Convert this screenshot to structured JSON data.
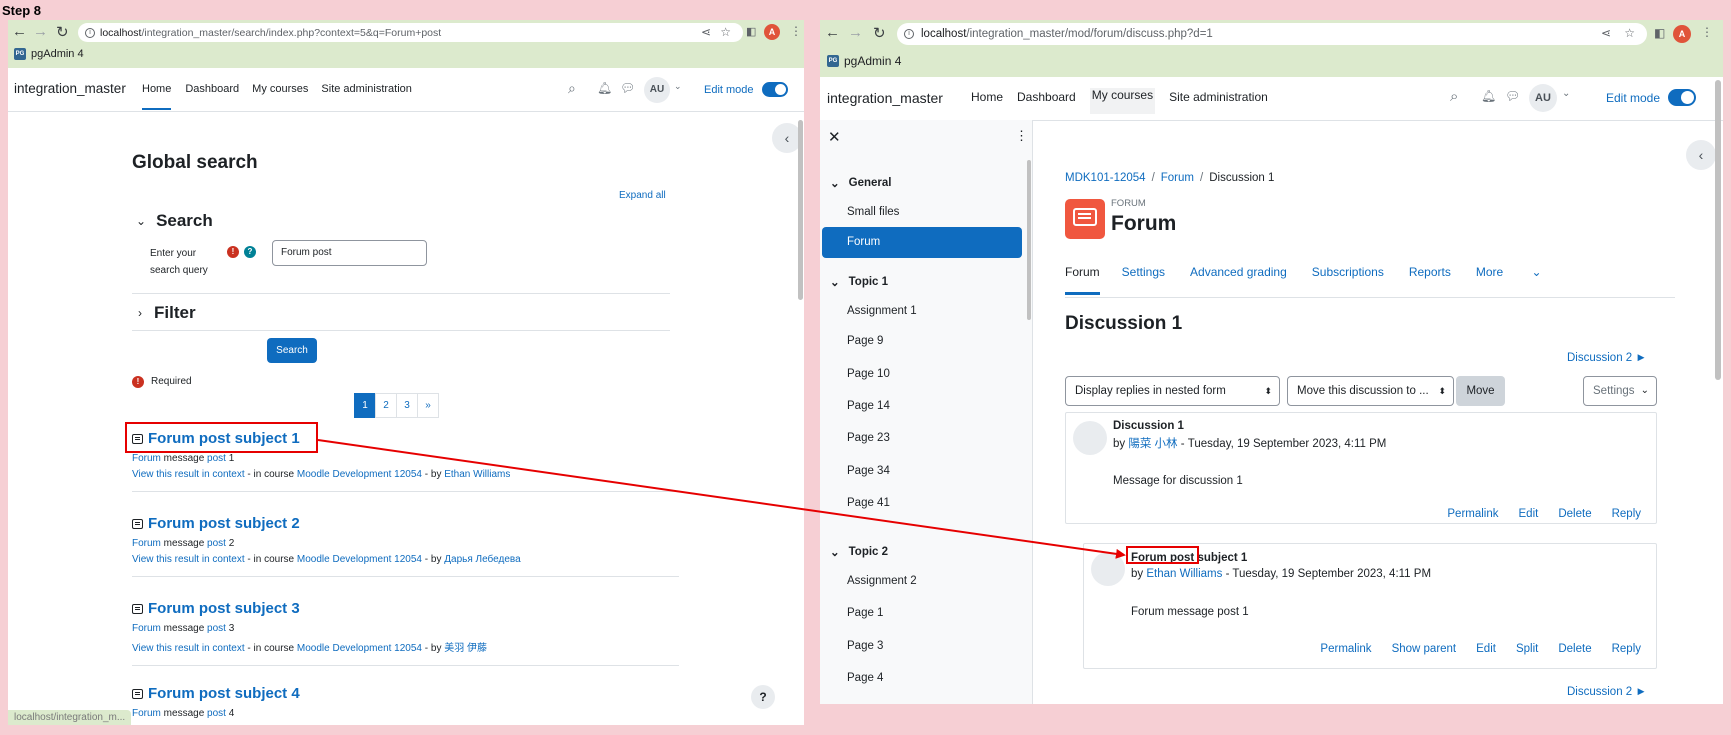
{
  "step_label": "Step 8",
  "left": {
    "url_host": "localhost",
    "url_path": "/integration_master/search/index.php?context=5&q=Forum+post",
    "bookmark": "pgAdmin 4",
    "site_name": "integration_master",
    "nav": [
      "Home",
      "Dashboard",
      "My courses",
      "Site administration"
    ],
    "user_initials": "AU",
    "edit_mode": "Edit mode",
    "page_title": "Global search",
    "expand_all": "Expand all",
    "search_heading": "Search",
    "query_label_1": "Enter your",
    "query_label_2": "search query",
    "query_value": "Forum post",
    "filter_heading": "Filter",
    "search_button": "Search",
    "required": "Required",
    "pages": [
      "1",
      "2",
      "3",
      "»"
    ],
    "results": [
      {
        "title": "Forum post subject 1",
        "w1": "Forum",
        "w2": " message ",
        "w3": "post",
        "w4": " 1",
        "ctx": "View this result in context",
        "sep1": " - in course ",
        "course": "Moodle Development 12054",
        "sep2": " - by ",
        "author": "Ethan Williams"
      },
      {
        "title": "Forum post subject 2",
        "w1": "Forum",
        "w2": " message ",
        "w3": "post",
        "w4": " 2",
        "ctx": "View this result in context",
        "sep1": " - in course ",
        "course": "Moodle Development 12054",
        "sep2": " - by ",
        "author": "Дарья Лебедева"
      },
      {
        "title": "Forum post subject 3",
        "w1": "Forum",
        "w2": " message ",
        "w3": "post",
        "w4": " 3",
        "ctx": "View this result in context",
        "sep1": " - in course ",
        "course": "Moodle Development 12054",
        "sep2": " - by ",
        "author": "美羽 伊藤"
      },
      {
        "title": "Forum post subject 4",
        "w1": "Forum",
        "w2": " message ",
        "w3": "post",
        "w4": " 4"
      }
    ],
    "status_url": "localhost/integration_m..."
  },
  "right": {
    "url_host": "localhost",
    "url_path": "/integration_master/mod/forum/discuss.php?d=1",
    "bookmark": "pgAdmin 4",
    "site_name": "integration_master",
    "nav": [
      "Home",
      "Dashboard",
      "My courses",
      "Site administration"
    ],
    "user_initials": "AU",
    "edit_mode": "Edit mode",
    "sidebar": {
      "sections": [
        {
          "label": "General",
          "items": [
            "Small files",
            "Forum"
          ]
        },
        {
          "label": "Topic 1",
          "items": [
            "Assignment 1",
            "Page 9",
            "Page 10",
            "Page 14",
            "Page 23",
            "Page 34",
            "Page 41"
          ]
        },
        {
          "label": "Topic 2",
          "items": [
            "Assignment 2",
            "Page 1",
            "Page 3",
            "Page 4"
          ]
        }
      ]
    },
    "breadcrumb": [
      "MDK101-12054",
      "Forum",
      "Discussion 1"
    ],
    "activity_type": "FORUM",
    "activity_title": "Forum",
    "tabs": [
      "Forum",
      "Settings",
      "Advanced grading",
      "Subscriptions",
      "Reports",
      "More"
    ],
    "discussion_title": "Discussion 1",
    "next_discussion": "Discussion 2 ►",
    "display_select": "Display replies in nested form",
    "move_select": "Move this discussion to ...",
    "move_button": "Move",
    "settings_button": "Settings",
    "posts": [
      {
        "subject": "Discussion 1",
        "by": "by ",
        "author": "陽菜 小林",
        "date": " - Tuesday, 19 September 2023, 4:11 PM",
        "message": "Message for discussion 1",
        "actions": [
          "Permalink",
          "Edit",
          "Delete",
          "Reply"
        ]
      },
      {
        "subject": "Forum post subject 1",
        "by": "by ",
        "author": "Ethan Williams",
        "date": " - Tuesday, 19 September 2023, 4:11 PM",
        "message": "Forum message post 1",
        "actions": [
          "Permalink",
          "Show parent",
          "Edit",
          "Split",
          "Delete",
          "Reply"
        ]
      }
    ]
  },
  "colors": {
    "accent": "#0f6cbf",
    "highlight": "#e60000",
    "browser_bar": "#dceacd",
    "background": "#f6cfd4"
  }
}
